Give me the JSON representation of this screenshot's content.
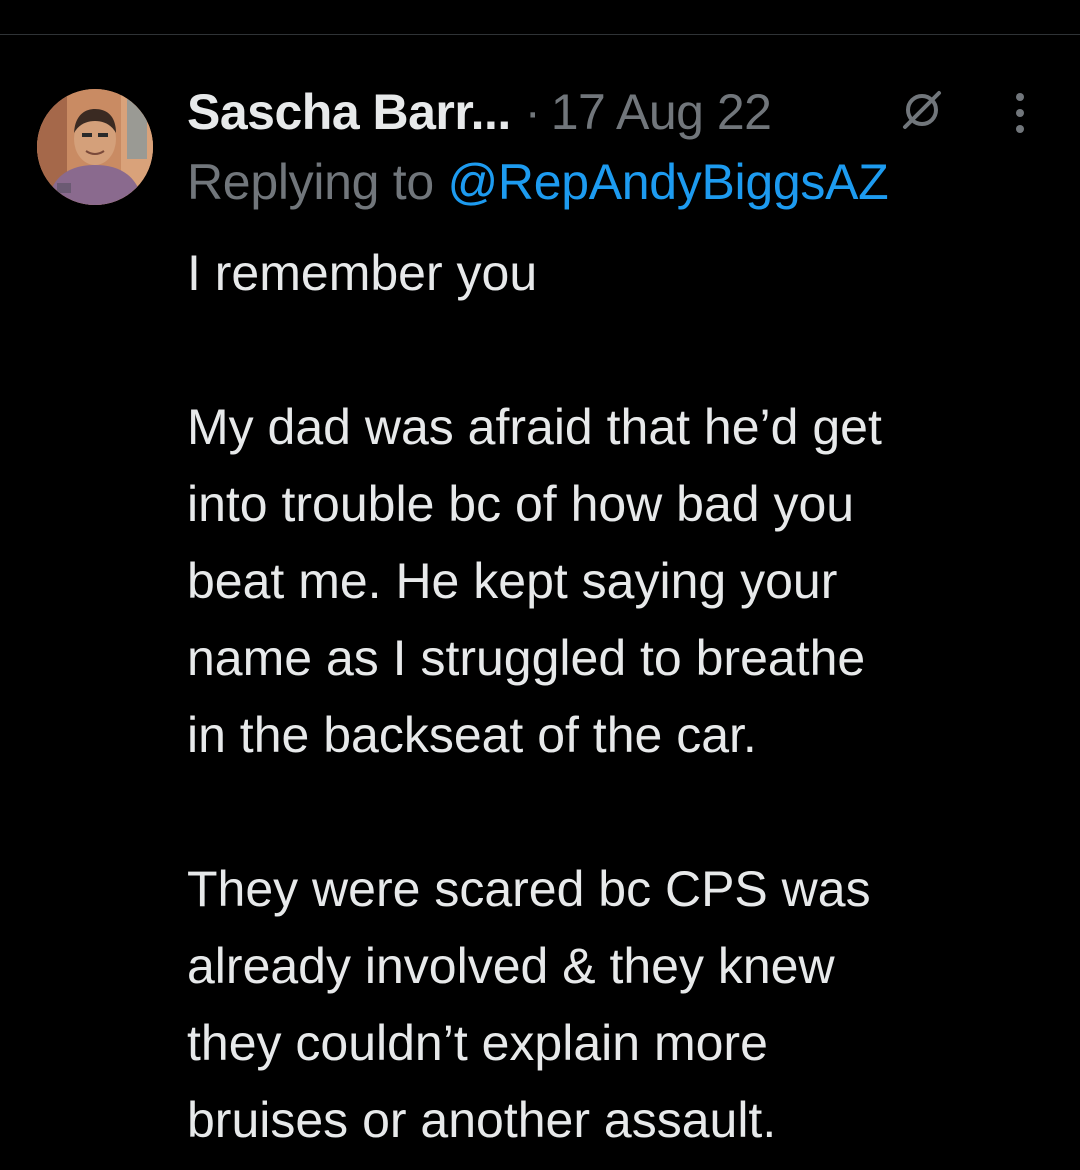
{
  "tweet": {
    "display_name": "Sascha Barr...",
    "separator": "·",
    "timestamp": "17 Aug 22",
    "status_icon": "muted-icon",
    "more_icon": "more-vertical-icon",
    "reply_prefix": "Replying to ",
    "reply_handle": "@RepAndyBiggsAZ",
    "paragraphs": [
      {
        "lines": [
          "I remember you"
        ]
      },
      {
        "lines": [
          "My dad was afraid that he’d get",
          "into trouble bc of how bad you",
          "beat me. He kept saying your",
          "name as I struggled to breathe",
          "in the backseat of the car."
        ]
      },
      {
        "lines": [
          "They were scared bc CPS was",
          "already involved & they knew",
          "they couldn’t explain more",
          "bruises or another assault."
        ]
      }
    ]
  },
  "colors": {
    "background": "#000000",
    "primary_text": "#e7e9ea",
    "secondary_text": "#71767b",
    "link": "#1d9bf0",
    "divider": "#2f3336"
  }
}
